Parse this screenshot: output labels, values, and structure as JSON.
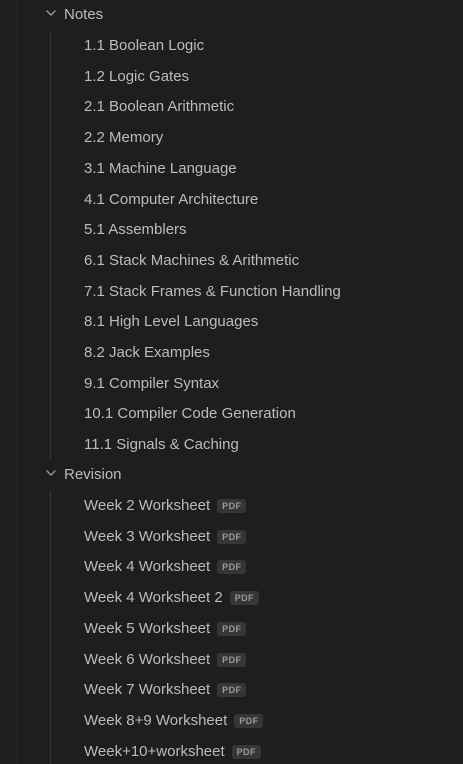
{
  "tree": {
    "folders": [
      {
        "label": "Notes",
        "items": [
          {
            "label": "1.1 Boolean Logic"
          },
          {
            "label": "1.2 Logic Gates"
          },
          {
            "label": "2.1 Boolean Arithmetic"
          },
          {
            "label": "2.2 Memory"
          },
          {
            "label": "3.1 Machine Language"
          },
          {
            "label": "4.1 Computer Architecture"
          },
          {
            "label": "5.1 Assemblers"
          },
          {
            "label": "6.1 Stack Machines & Arithmetic"
          },
          {
            "label": "7.1 Stack Frames & Function Handling"
          },
          {
            "label": "8.1 High Level Languages"
          },
          {
            "label": "8.2 Jack Examples"
          },
          {
            "label": "9.1 Compiler Syntax"
          },
          {
            "label": "10.1 Compiler Code Generation"
          },
          {
            "label": "11.1 Signals & Caching"
          }
        ]
      },
      {
        "label": "Revision",
        "items": [
          {
            "label": "Week 2 Worksheet",
            "badge": "PDF"
          },
          {
            "label": "Week 3 Worksheet",
            "badge": "PDF"
          },
          {
            "label": "Week 4 Worksheet",
            "badge": "PDF"
          },
          {
            "label": "Week 4 Worksheet 2",
            "badge": "PDF"
          },
          {
            "label": "Week 5 Worksheet",
            "badge": "PDF"
          },
          {
            "label": "Week 6 Worksheet",
            "badge": "PDF"
          },
          {
            "label": "Week 7 Worksheet",
            "badge": "PDF"
          },
          {
            "label": "Week 8+9 Worksheet",
            "badge": "PDF"
          },
          {
            "label": "Week+10+worksheet",
            "badge": "PDF"
          }
        ]
      }
    ]
  },
  "colors": {
    "background": "#1e1e1e",
    "text": "#bcbcbc",
    "badge_bg": "#363636",
    "badge_text": "#9a9a9a",
    "guide": "#363636"
  },
  "icons": {
    "folder_toggle": "chevron-down-icon"
  }
}
